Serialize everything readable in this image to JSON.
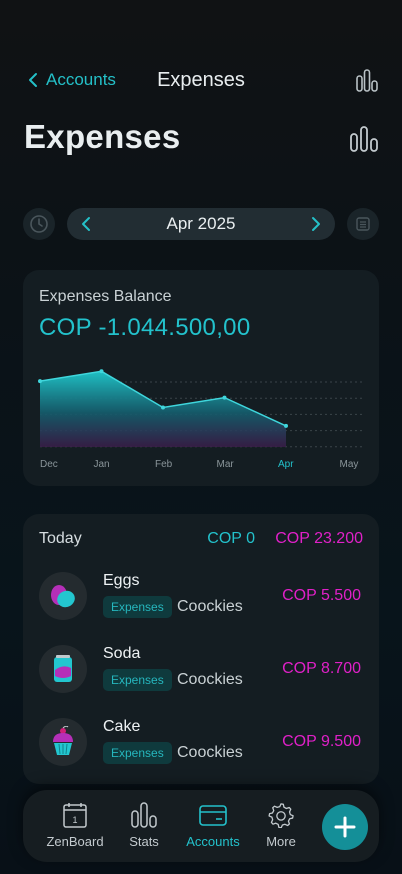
{
  "nav": {
    "back_label": "Accounts",
    "title": "Expenses"
  },
  "page": {
    "title": "Expenses"
  },
  "period": {
    "label": "Apr 2025"
  },
  "balance": {
    "label": "Expenses Balance",
    "value": "COP -1.044.500,00"
  },
  "chart_data": {
    "type": "area",
    "categories": [
      "Dec",
      "Jan",
      "Feb",
      "Mar",
      "Apr",
      "May"
    ],
    "series": [
      {
        "values": [
          1.0,
          1.15,
          0.6,
          0.75,
          0.32,
          null
        ]
      }
    ],
    "highlighted": "Apr",
    "grid": true,
    "colors": {
      "area": "#1fc0c4",
      "line": "#3fd6dc",
      "highlight_label": "#23c2cc"
    }
  },
  "transactions": {
    "group_label": "Today",
    "income_total": "COP 0",
    "expense_total": "COP 23.200",
    "items": [
      {
        "name": "Eggs",
        "category": "Expenses",
        "account": "Coockies",
        "amount": "COP 5.500",
        "icon": "eggs-icon"
      },
      {
        "name": "Soda",
        "category": "Expenses",
        "account": "Coockies",
        "amount": "COP 8.700",
        "icon": "soda-can-icon"
      },
      {
        "name": "Cake",
        "category": "Expenses",
        "account": "Coockies",
        "amount": "COP 9.500",
        "icon": "cupcake-icon"
      }
    ]
  },
  "tabbar": {
    "items": [
      {
        "label": "ZenBoard",
        "icon": "calendar-icon"
      },
      {
        "label": "Stats",
        "icon": "bar-chart-icon"
      },
      {
        "label": "Accounts",
        "icon": "card-icon",
        "active": true
      },
      {
        "label": "More",
        "icon": "gear-icon"
      }
    ],
    "calendar_day": "1"
  },
  "colors": {
    "accent": "#23c2cc",
    "expense": "#e020c8",
    "background": "#0b1217"
  }
}
